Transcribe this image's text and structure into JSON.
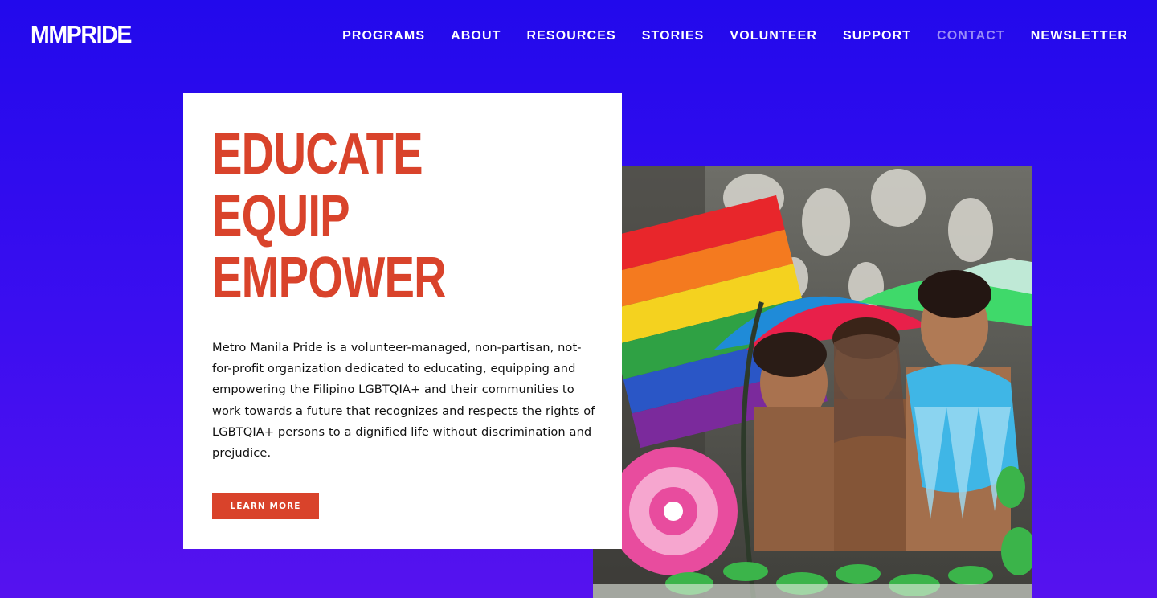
{
  "header": {
    "logo": "MMPRIDE",
    "nav": [
      {
        "label": "PROGRAMS",
        "active": false
      },
      {
        "label": "ABOUT",
        "active": false
      },
      {
        "label": "RESOURCES",
        "active": false
      },
      {
        "label": "STORIES",
        "active": false
      },
      {
        "label": "VOLUNTEER",
        "active": false
      },
      {
        "label": "SUPPORT",
        "active": false
      },
      {
        "label": "CONTACT",
        "active": true
      },
      {
        "label": "NEWSLETTER",
        "active": false
      }
    ]
  },
  "hero": {
    "headline": [
      "EDUCATE",
      "EQUIP",
      "EMPOWER"
    ],
    "description": "Metro Manila Pride is a volunteer-managed, non-partisan, not-for-profit organization dedicated to educating, equipping and empowering the Filipino LGBTQIA+ and their communities to work towards a future that recognizes and respects the rights of LGBTQIA+ persons to a dignified life without discrimination and prejudice.",
    "cta_label": "LEARN MORE"
  },
  "colors": {
    "background_top": "#2209ec",
    "background_bottom": "#5612ef",
    "accent": "#d9432b",
    "nav_active": "#9a8cf7"
  }
}
